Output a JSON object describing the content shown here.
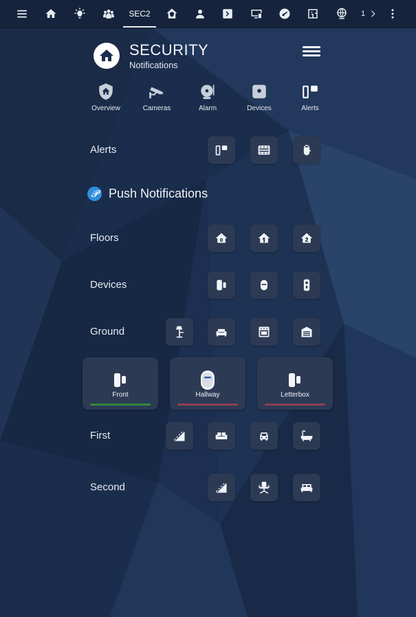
{
  "topbar": {
    "active_tab_label": "SEC2",
    "overflow_text": "1",
    "tabs": [
      "menu-icon",
      "home-icon",
      "bulb-icon",
      "group-icon",
      "SEC2",
      "house-shield-icon",
      "person-icon",
      "chevron-box-icon",
      "monitor-icon",
      "swirl-icon",
      "floorplan-icon",
      "globe-icon",
      "1 chevron-icon",
      "more-vert-icon"
    ]
  },
  "header": {
    "title": "SECURITY",
    "subtitle": "Notifications"
  },
  "nav": [
    {
      "label": "Overview",
      "icon": "shield-home-icon"
    },
    {
      "label": "Cameras",
      "icon": "cctv-icon"
    },
    {
      "label": "Alarm",
      "icon": "alarm-bell-icon"
    },
    {
      "label": "Devices",
      "icon": "device-icon"
    },
    {
      "label": "Alerts",
      "icon": "door-sensor-icon"
    }
  ],
  "rows": {
    "alerts": "Alerts",
    "push_title": "Push Notifications",
    "push_icon_glyph": "𝓟",
    "floors": "Floors",
    "devices": "Devices",
    "ground": "Ground",
    "first": "First",
    "second": "Second"
  },
  "cards": [
    {
      "label": "Front",
      "icon": "door-sensor-icon",
      "bar_color": "#2e8b3e"
    },
    {
      "label": "Hallway",
      "icon": "motion-sensor-icon",
      "bar_color": "#8c3f55"
    },
    {
      "label": "Letterbox",
      "icon": "door-sensor-icon",
      "bar_color": "#8c3f55"
    }
  ],
  "colors": {
    "background": "#1b2e4e",
    "topbar": "#15243c",
    "tile": "#2c3a54",
    "accent_blue": "#2f8ddb"
  }
}
